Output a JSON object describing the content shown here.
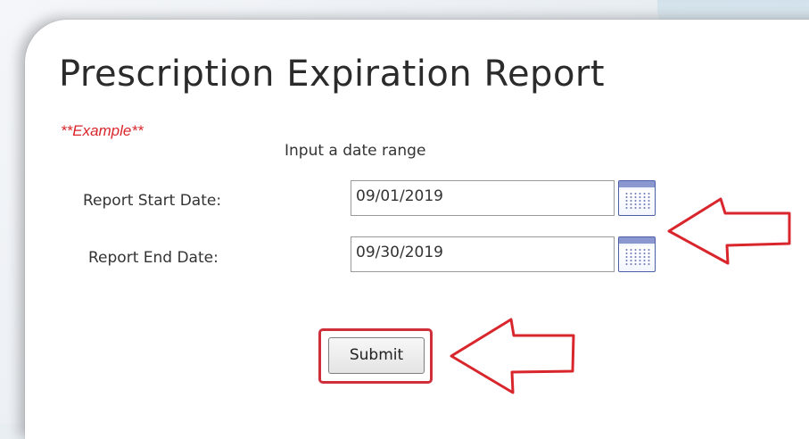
{
  "page": {
    "title": "Prescription Expiration Report",
    "example_note": "**Example**",
    "instruction": "Input a date range"
  },
  "form": {
    "start_date": {
      "label": "Report Start Date:",
      "value": "09/01/2019",
      "calendar_icon": "calendar-icon"
    },
    "end_date": {
      "label": "Report End Date:",
      "value": "09/30/2019",
      "calendar_icon": "calendar-icon"
    },
    "submit_label": "Submit"
  },
  "annotations": {
    "arrow_color": "#d8262c",
    "highlight_color": "#cf2f3a",
    "arrows": [
      "annotation-arrow-dates",
      "annotation-arrow-submit"
    ]
  }
}
